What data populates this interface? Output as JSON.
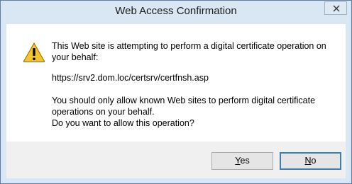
{
  "window": {
    "title": "Web Access Confirmation"
  },
  "message": {
    "intro": "This Web site is attempting to perform a digital certificate operation on your behalf:",
    "url": "https://srv2.dom.loc/certsrv/certfnsh.asp",
    "warning_line1": "You should only allow known Web sites to perform digital certificate operations on your behalf.",
    "warning_line2": "Do you want to allow this operation?"
  },
  "buttons": {
    "yes": {
      "mnemonic": "Y",
      "rest": "es"
    },
    "no": {
      "mnemonic": "N",
      "rest": "o"
    }
  },
  "icons": {
    "warning": "warning-icon",
    "close": "close-icon"
  },
  "colors": {
    "frame": "#d9e6f3",
    "warning_fill": "#f4c430",
    "default_button_border": "#3c7fb1"
  }
}
